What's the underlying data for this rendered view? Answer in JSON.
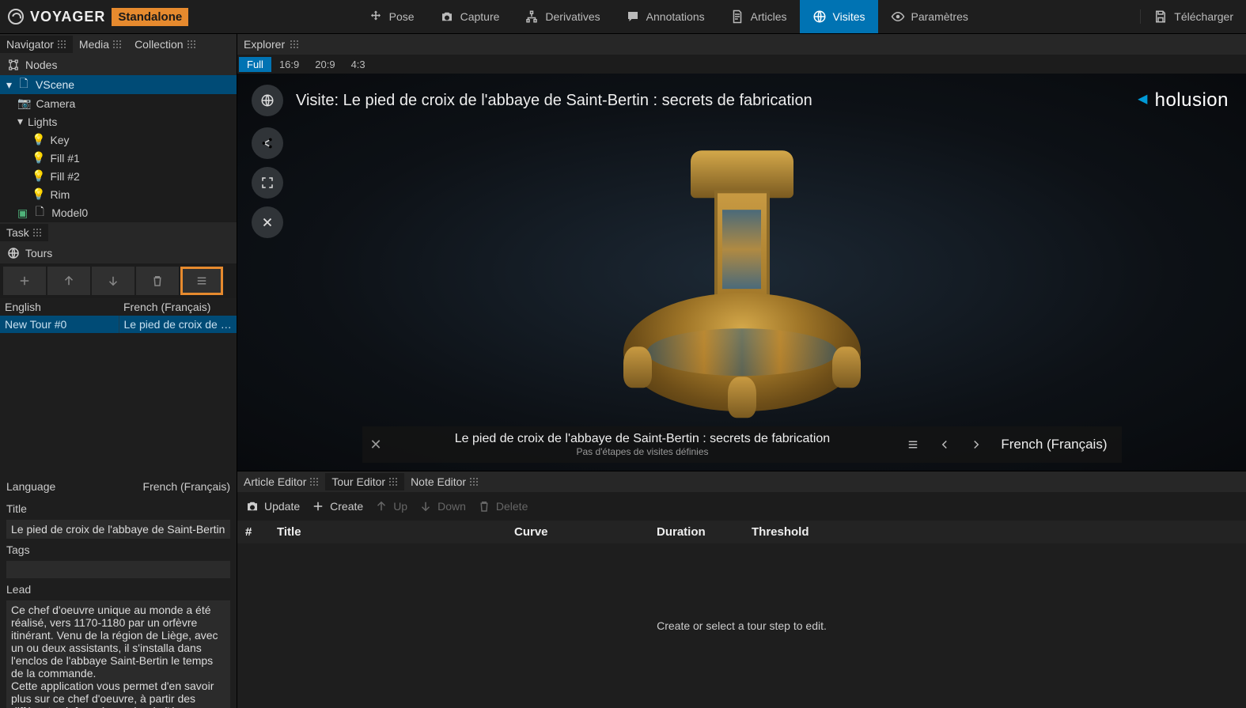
{
  "app": {
    "brand": "VOYAGER",
    "mode": "Standalone"
  },
  "topTabs": {
    "pose": "Pose",
    "capture": "Capture",
    "derivatives": "Derivatives",
    "annotations": "Annotations",
    "articles": "Articles",
    "visites": "Visites",
    "parametres": "Paramètres",
    "download": "Télécharger"
  },
  "leftTabs": {
    "navigator": "Navigator",
    "media": "Media",
    "collection": "Collection",
    "nodes": "Nodes",
    "task": "Task",
    "tours": "Tours"
  },
  "tree": {
    "vscene": "VScene",
    "camera": "Camera",
    "lights": "Lights",
    "key": "Key",
    "fill1": "Fill #1",
    "fill2": "Fill #2",
    "rim": "Rim",
    "model0": "Model0"
  },
  "toursTable": {
    "colEnglish": "English",
    "colFrench": "French (Français)",
    "rowEnglish": "New Tour #0",
    "rowFrench": "Le pied de croix de l'abbaye de Saint-Bertin : secrets de fabrication"
  },
  "tourForm": {
    "languageLabel": "Language",
    "languageValue": "French (Français)",
    "titleLabel": "Title",
    "titleValue": "Le pied de croix de l'abbaye de Saint-Bertin : secrets de fabrication",
    "tagsLabel": "Tags",
    "leadLabel": "Lead",
    "leadValue": "Ce chef d'oeuvre unique au monde a été réalisé, vers 1170-1180 par un orfèvre itinérant. Venu de la région de Liège, avec un ou deux assistants, il s'installa dans l'enclos de l'abbaye Saint-Bertin le temps de la commande.\nCette application vous permet d'en savoir plus sur ce chef d'oeuvre, à partir des différentes icônes à gauche de l'écran."
  },
  "explorer": {
    "label": "Explorer",
    "aspectFull": "Full",
    "aspect169": "16:9",
    "aspect209": "20:9",
    "aspect43": "4:3",
    "visitTitle": "Visite: Le pied de croix de l'abbaye de Saint-Bertin : secrets de fabrication",
    "brand": "holusion"
  },
  "vpBottom": {
    "title": "Le pied de croix de l'abbaye de Saint-Bertin : secrets de fabrication",
    "subtitle": "Pas d'étapes de visites définies",
    "lang": "French (Français)"
  },
  "bottomTabs": {
    "article": "Article Editor",
    "tour": "Tour Editor",
    "note": "Note Editor"
  },
  "bottomToolbar": {
    "update": "Update",
    "create": "Create",
    "up": "Up",
    "down": "Down",
    "delete": "Delete"
  },
  "stepsTable": {
    "num": "#",
    "title": "Title",
    "curve": "Curve",
    "duration": "Duration",
    "threshold": "Threshold"
  },
  "stepsEmpty": "Create or select a tour step to edit."
}
